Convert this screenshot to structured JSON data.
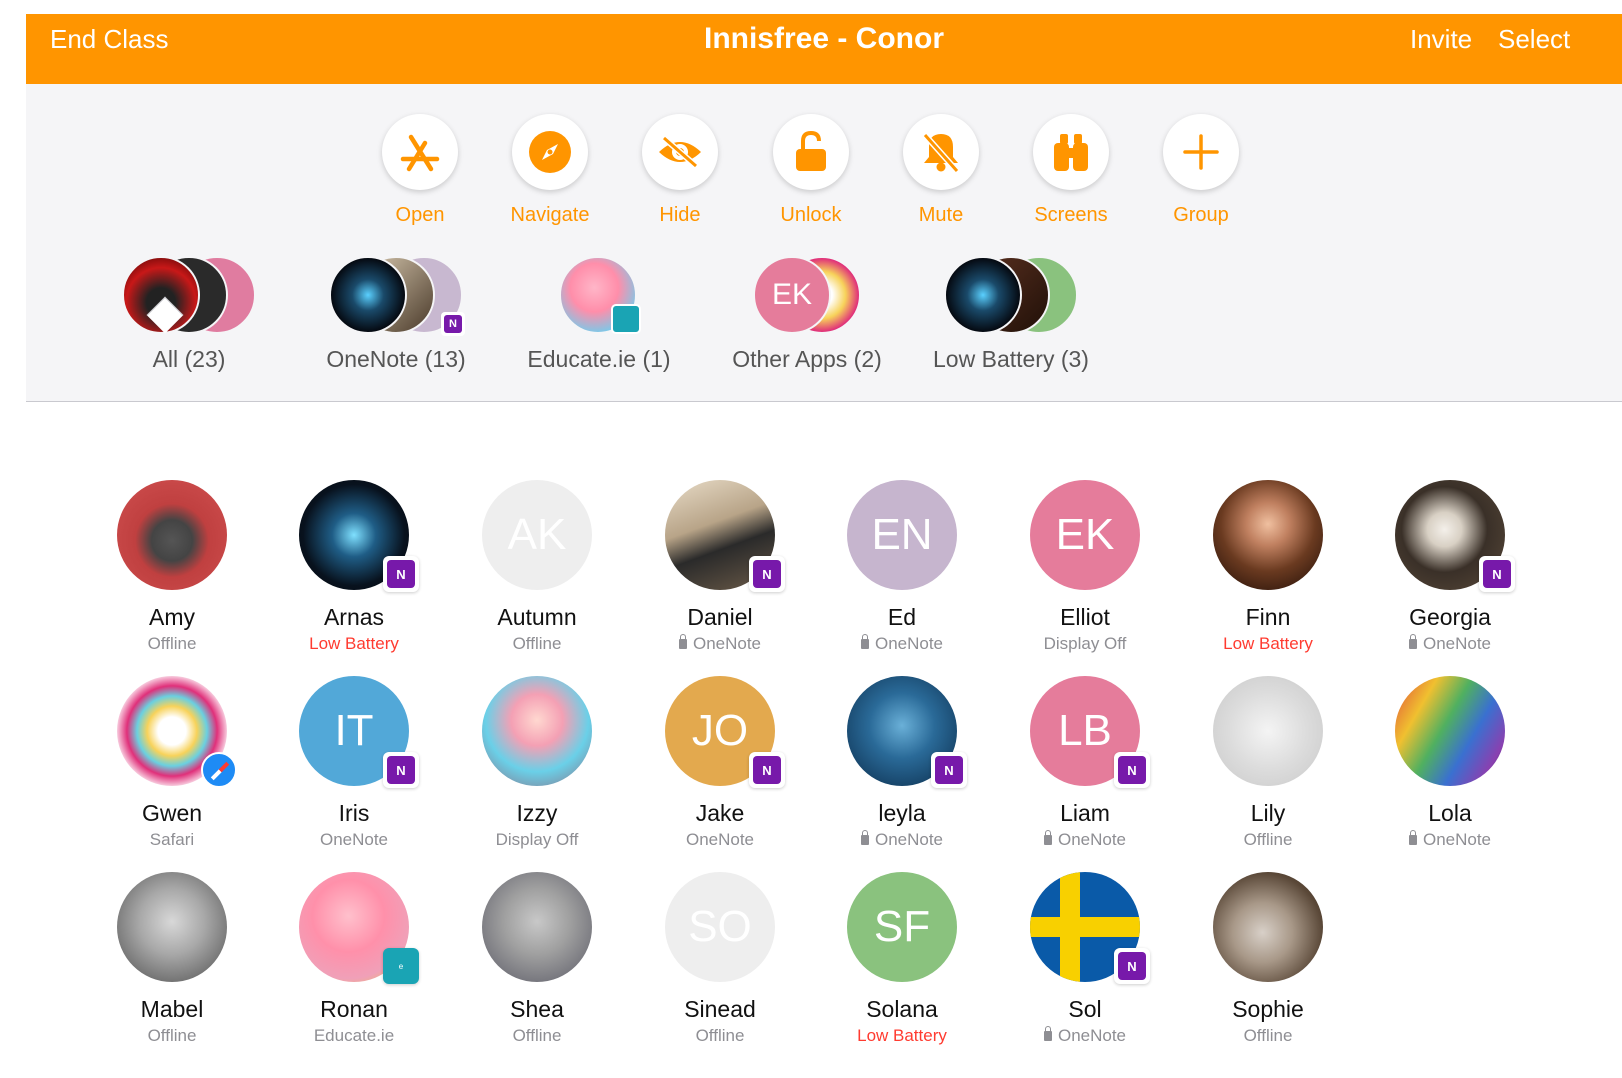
{
  "header": {
    "end_label": "End Class",
    "title": "Innisfree - Conor",
    "invite_label": "Invite",
    "select_label": "Select"
  },
  "actions": [
    {
      "label": "Open",
      "icon": "app-store-icon"
    },
    {
      "label": "Navigate",
      "icon": "compass-icon"
    },
    {
      "label": "Hide",
      "icon": "eye-slash-icon"
    },
    {
      "label": "Unlock",
      "icon": "unlock-icon"
    },
    {
      "label": "Mute",
      "icon": "bell-slash-icon"
    },
    {
      "label": "Screens",
      "icon": "binoculars-icon"
    },
    {
      "label": "Group",
      "icon": "plus-icon"
    }
  ],
  "filters": [
    {
      "label": "All (23)",
      "selected": true
    },
    {
      "label": "OneNote (13)"
    },
    {
      "label": "Educate.ie (1)"
    },
    {
      "label": "Other Apps (2)"
    },
    {
      "label": "Low Battery (3)"
    }
  ],
  "filter_stacks": {
    "other_apps_initials": "EK"
  },
  "students": [
    {
      "name": "Amy",
      "status": "Offline"
    },
    {
      "name": "Arnas",
      "status": "Low Battery"
    },
    {
      "name": "Autumn",
      "status": "Offline",
      "initials": "AK"
    },
    {
      "name": "Daniel",
      "status": "OneNote"
    },
    {
      "name": "Ed",
      "status": "OneNote",
      "initials": "EN"
    },
    {
      "name": "Elliot",
      "status": "Display Off",
      "initials": "EK"
    },
    {
      "name": "Finn",
      "status": "Low Battery"
    },
    {
      "name": "Georgia",
      "status": "OneNote"
    },
    {
      "name": "Gwen",
      "status": "Safari"
    },
    {
      "name": "Iris",
      "status": "OneNote",
      "initials": "IT"
    },
    {
      "name": "Izzy",
      "status": "Display Off"
    },
    {
      "name": "Jake",
      "status": "OneNote",
      "initials": "JO"
    },
    {
      "name": "leyla",
      "status": "OneNote"
    },
    {
      "name": "Liam",
      "status": "OneNote",
      "initials": "LB"
    },
    {
      "name": "Lily",
      "status": "Offline"
    },
    {
      "name": "Lola",
      "status": "OneNote"
    },
    {
      "name": "Mabel",
      "status": "Offline"
    },
    {
      "name": "Ronan",
      "status": "Educate.ie"
    },
    {
      "name": "Shea",
      "status": "Offline"
    },
    {
      "name": "Sinead",
      "status": "Offline",
      "initials": "SO"
    },
    {
      "name": "Solana",
      "status": "Low Battery",
      "initials": "SF"
    },
    {
      "name": "Sol",
      "status": "OneNote"
    },
    {
      "name": "Sophie",
      "status": "Offline"
    }
  ],
  "badges": {
    "onenote_glyph": "N",
    "educate_glyph": "e"
  },
  "colors": {
    "accent": "#ff9500",
    "warning": "#ff3b30",
    "onenote": "#7719aa"
  }
}
